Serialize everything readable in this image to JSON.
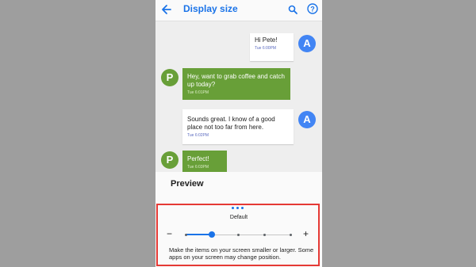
{
  "appbar": {
    "title": "Display size",
    "back_icon": "arrow-back-icon",
    "search_icon": "search-icon",
    "help_icon": "help-icon"
  },
  "messages": [
    {
      "side": "out",
      "text": "Hi Pete!",
      "time": "Tue 6:00PM",
      "avatar": "A"
    },
    {
      "side": "in",
      "text": "Hey, want to grab coffee and catch up today?",
      "time": "Tue 6:01PM",
      "avatar": "P"
    },
    {
      "side": "out",
      "text": "Sounds great. I know of a good place not too far from here.",
      "time": "Tue 6:02PM",
      "avatar": "A"
    },
    {
      "side": "in",
      "text": "Perfect!",
      "time": "Tue 6:03PM",
      "avatar": "P"
    }
  ],
  "preview": {
    "label": "Preview"
  },
  "size_control": {
    "label": "Default",
    "minus": "−",
    "plus": "+",
    "steps": 5,
    "selected_step": 1,
    "description": "Make the items on your screen smaller or larger. Some apps on your screen may change position."
  },
  "colors": {
    "accent": "#1a73e8",
    "incoming_bubble": "#689f38",
    "highlight_border": "#e53935"
  }
}
